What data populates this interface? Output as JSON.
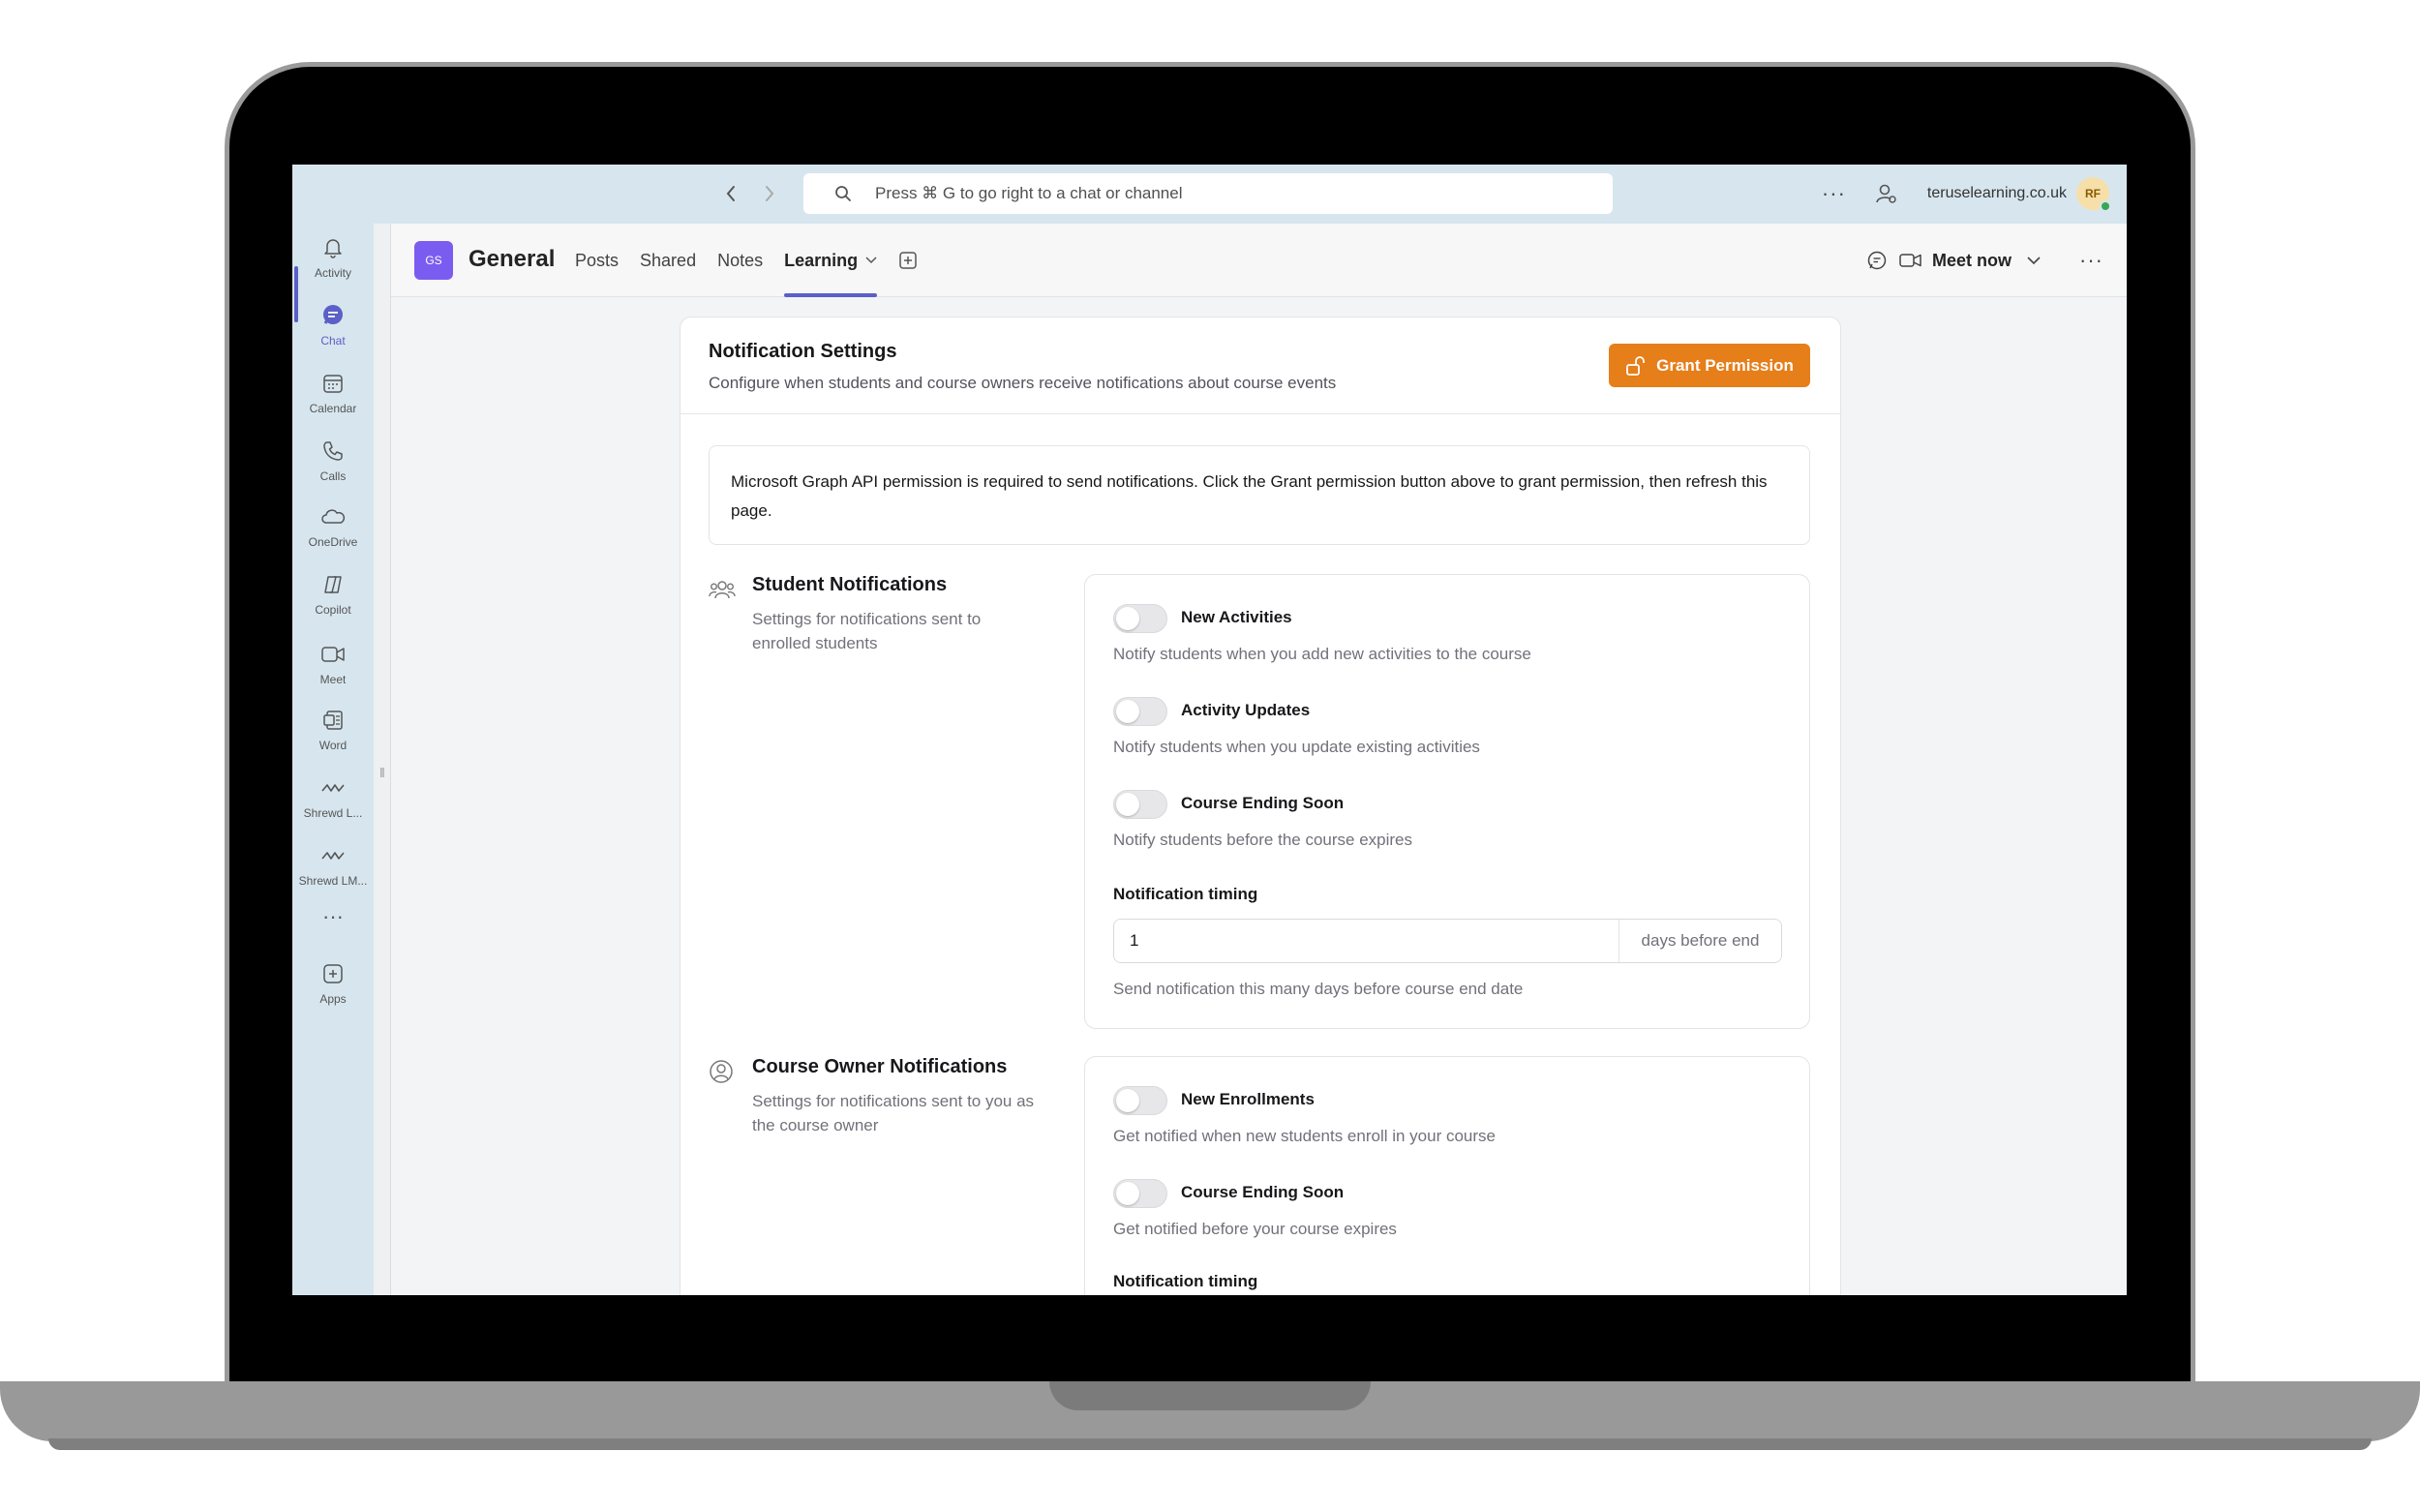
{
  "topbar": {
    "search_placeholder": "Press ⌘ G to go right to a chat or channel",
    "more_label": "···",
    "tenant": "teruselearning.co.uk",
    "avatar_initials": "RF"
  },
  "rail": {
    "items": [
      {
        "label": "Activity",
        "icon": "bell-icon"
      },
      {
        "label": "Chat",
        "icon": "chat-icon"
      },
      {
        "label": "Calendar",
        "icon": "calendar-icon"
      },
      {
        "label": "Calls",
        "icon": "phone-icon"
      },
      {
        "label": "OneDrive",
        "icon": "cloud-icon"
      },
      {
        "label": "Copilot",
        "icon": "copilot-icon"
      },
      {
        "label": "Meet",
        "icon": "video-icon"
      },
      {
        "label": "Word",
        "icon": "word-icon"
      },
      {
        "label": "Shrewd L...",
        "icon": "shrewd-icon"
      },
      {
        "label": "Shrewd LM...",
        "icon": "shrewd-icon"
      },
      {
        "label": "Apps",
        "icon": "apps-icon"
      }
    ],
    "more_label": "···",
    "active": "Chat"
  },
  "channel": {
    "team_initials": "GS",
    "title": "General",
    "tabs": [
      {
        "label": "Posts"
      },
      {
        "label": "Shared"
      },
      {
        "label": "Notes"
      },
      {
        "label": "Learning"
      }
    ],
    "active_tab": "Learning",
    "meet_now": "Meet now",
    "more_label": "···"
  },
  "card": {
    "title": "Notification Settings",
    "subtitle": "Configure when students and course owners receive notifications about course events",
    "grant_button": "Grant Permission",
    "alert": "Microsoft Graph API permission is required to send notifications. Click the Grant permission button above to grant permission, then refresh this page."
  },
  "student_section": {
    "title": "Student Notifications",
    "description": "Settings for notifications sent to enrolled students",
    "settings": [
      {
        "label": "New Activities",
        "description": "Notify students when you add new activities to the course",
        "enabled": false
      },
      {
        "label": "Activity Updates",
        "description": "Notify students when you update existing activities",
        "enabled": false
      },
      {
        "label": "Course Ending Soon",
        "description": "Notify students before the course expires",
        "enabled": false
      }
    ],
    "timing_label": "Notification timing",
    "timing_value": "1",
    "timing_suffix": "days before end",
    "timing_help": "Send notification this many days before course end date"
  },
  "owner_section": {
    "title": "Course Owner Notifications",
    "description": "Settings for notifications sent to you as the course owner",
    "settings": [
      {
        "label": "New Enrollments",
        "description": "Get notified when new students enroll in your course",
        "enabled": false
      },
      {
        "label": "Course Ending Soon",
        "description": "Get notified before your course expires",
        "enabled": false
      }
    ],
    "timing_label": "Notification timing"
  },
  "colors": {
    "accent": "#5b5fc7",
    "grant_button": "#e67e1a",
    "topbar": "#d7e6ee",
    "team_avatar": "#7b5cf0"
  }
}
